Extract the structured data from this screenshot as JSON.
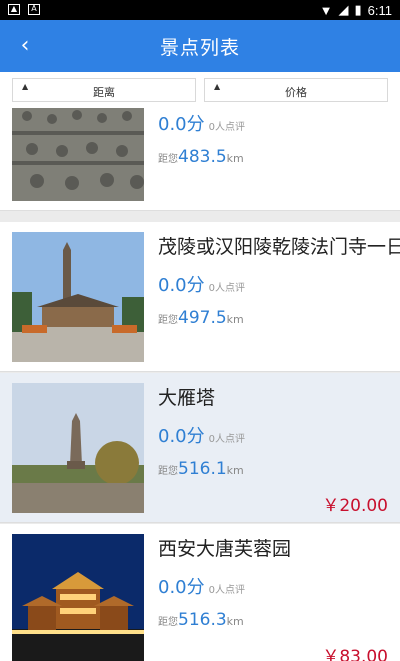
{
  "statusbar": {
    "time": "6:11"
  },
  "header": {
    "title": "景点列表"
  },
  "sort": {
    "distance": "距离",
    "price": "价格"
  },
  "labels": {
    "distance_prefix": "距您",
    "rating_suffix": "0人点评"
  },
  "items": [
    {
      "name": "",
      "score": "0.0分",
      "reviews": "0人点评",
      "distance": "483.5",
      "unit": "km",
      "price": ""
    },
    {
      "name": "茂陵或汉阳陵乾陵法门寺一日游",
      "score": "0.0分",
      "reviews": "0人点评",
      "distance": "497.5",
      "unit": "km",
      "price": ""
    },
    {
      "name": "大雁塔",
      "score": "0.0分",
      "reviews": "0人点评",
      "distance": "516.1",
      "unit": "km",
      "price": "￥20.00"
    },
    {
      "name": "西安大唐芙蓉园",
      "score": "0.0分",
      "reviews": "0人点评",
      "distance": "516.3",
      "unit": "km",
      "price": "￥83.00"
    }
  ]
}
